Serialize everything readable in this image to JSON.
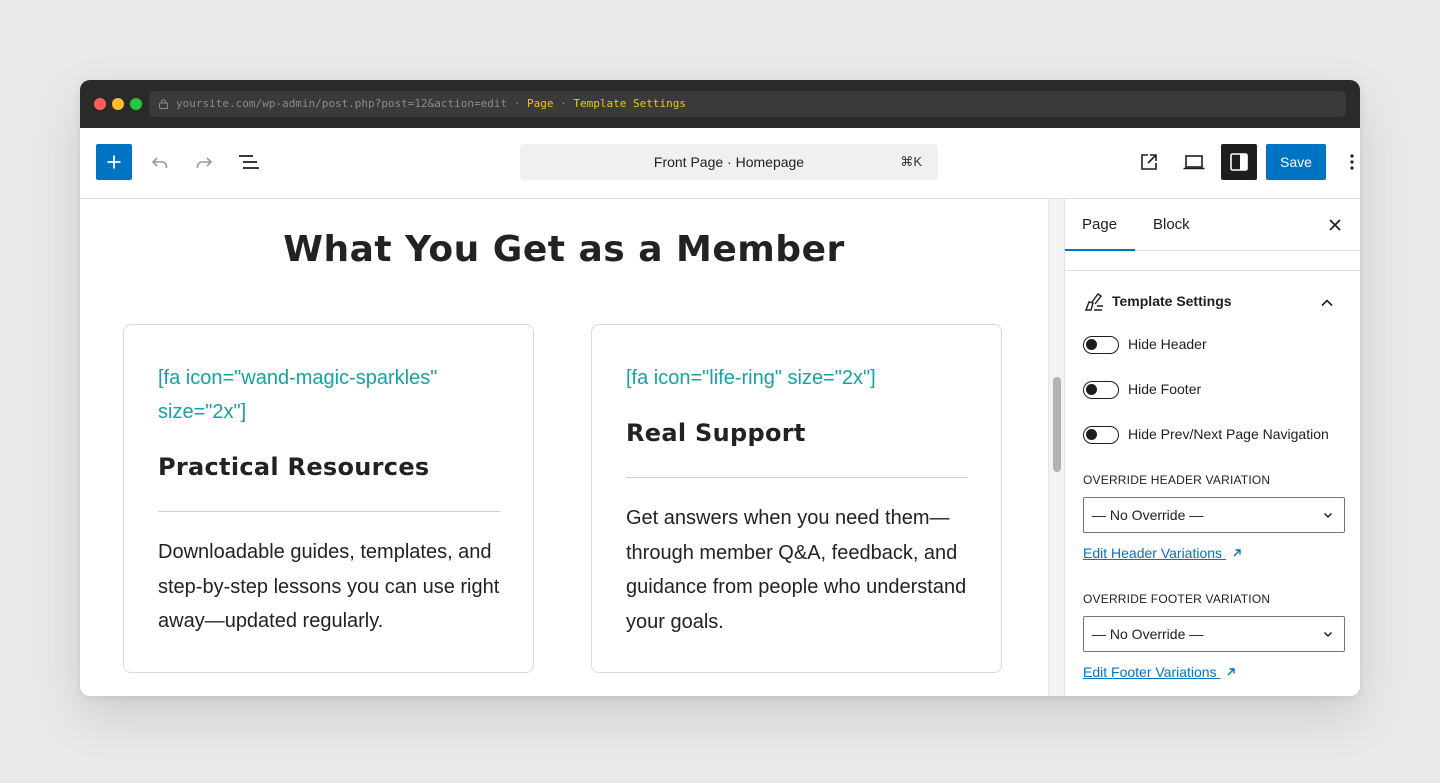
{
  "browser": {
    "url": "yoursite.com/wp-admin/post.php?post=12&action=edit",
    "separator": "·",
    "crumb_page": "Page",
    "crumb_section": "Template Settings"
  },
  "toolbar": {
    "document_title": "Front Page · Homepage",
    "shortcut": "⌘K",
    "save_label": "Save"
  },
  "canvas": {
    "heading": "What You Get as a Member",
    "cards": [
      {
        "shortcode": "[fa icon=\"wand-magic-sparkles\" size=\"2x\"]",
        "title": "Practical Resources",
        "body": "Downloadable guides, templates, and step-by-step lessons you can use right away—updated regularly."
      },
      {
        "shortcode": "[fa icon=\"life-ring\" size=\"2x\"]",
        "title": "Real Support",
        "body": "Get answers when you need them—through member Q&A, feedback, and guidance from people who understand your goals."
      }
    ]
  },
  "sidebar": {
    "tabs": [
      "Page",
      "Block"
    ],
    "panel_title": "Template Settings",
    "toggles": [
      {
        "label": "Hide Header",
        "checked": false
      },
      {
        "label": "Hide Footer",
        "checked": false
      },
      {
        "label": "Hide Prev/Next Page Navigation",
        "checked": false
      }
    ],
    "header_variation": {
      "label": "OVERRIDE HEADER VARIATION",
      "value": "— No Override —",
      "link": "Edit Header Variations"
    },
    "footer_variation": {
      "label": "OVERRIDE FOOTER VARIATION",
      "value": "— No Override —",
      "link": "Edit Footer Variations"
    }
  },
  "colors": {
    "accent": "#0073c2",
    "shortcode_teal": "#16a1a5",
    "url_highlight": "#f5c518"
  },
  "icons": [
    "lock-icon",
    "plus-icon",
    "undo-icon",
    "redo-icon",
    "list-view-icon",
    "external-link-icon",
    "desktop-preview-icon",
    "sidebar-toggle-icon",
    "more-vertical-icon",
    "close-icon",
    "brush-icon",
    "chevron-up-icon",
    "chevron-down-icon",
    "arrow-up-right-icon"
  ]
}
